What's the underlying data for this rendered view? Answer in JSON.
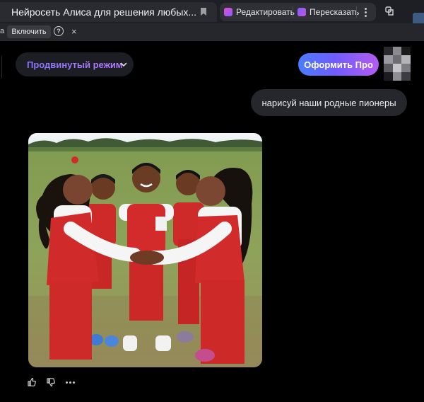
{
  "browser": {
    "tab_title": "Нейросеть Алиса для решения любых...",
    "edit_label": "Редактировать",
    "retell_label": "Пересказать"
  },
  "infobar": {
    "cut_text": "а",
    "enable_label": "Включить",
    "help_glyph": "?",
    "close_glyph": "×"
  },
  "chat": {
    "mode_label": "Продвинутый режим",
    "pro_label": "Оформить Про",
    "user_message": "нарисуй наши родные пионеры"
  },
  "colors": {
    "background": "#000000",
    "bubble": "#26272d",
    "accent_gradient_start": "#4a7dff",
    "accent_gradient_end": "#b45bf0",
    "mode_text": "#8a74ff"
  },
  "icons": [
    "bookmark-icon",
    "edit-icon",
    "retell-icon",
    "more-icon",
    "extension-icon",
    "help-icon",
    "close-icon",
    "chevron-down-icon",
    "thumbs-up-icon",
    "thumbs-down-icon",
    "more-actions-icon"
  ]
}
